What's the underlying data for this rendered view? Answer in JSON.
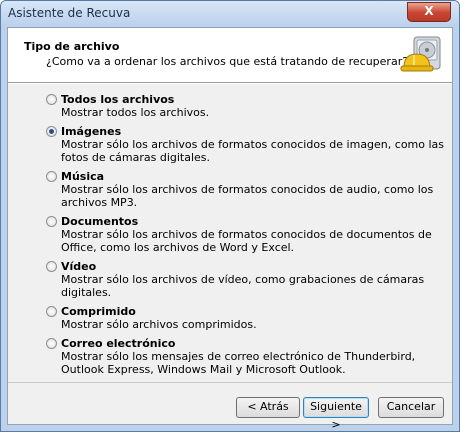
{
  "window": {
    "title": "Asistente de Recuva",
    "close_label": "X"
  },
  "header": {
    "title": "Tipo de archivo",
    "subtitle": "¿Como va a ordenar los archivos que está tratando de recuperar?",
    "logo_icon": "recuva-hardhat-disk-icon"
  },
  "options": [
    {
      "label": "Todos los archivos",
      "desc": "Mostrar todos los archivos.",
      "selected": false
    },
    {
      "label": "Imágenes",
      "desc": "Mostrar sólo los archivos de formatos conocidos de imagen, como las fotos de cámaras digitales.",
      "selected": true
    },
    {
      "label": "Música",
      "desc": "Mostrar sólo los archivos de formatos conocidos de audio, como los archivos MP3.",
      "selected": false
    },
    {
      "label": "Documentos",
      "desc": "Mostrar sólo los archivos de formatos conocidos de documentos de Office, como los archivos de Word y Excel.",
      "selected": false
    },
    {
      "label": "Vídeo",
      "desc": "Mostrar sólo los archivos de vídeo, como grabaciones de cámaras digitales.",
      "selected": false
    },
    {
      "label": "Comprimido",
      "desc": "Mostrar sólo archivos comprimidos.",
      "selected": false
    },
    {
      "label": "Correo electrónico",
      "desc": "Mostrar sólo los mensajes de correo electrónico de Thunderbird, Outlook Express, Windows Mail y Microsoft Outlook.",
      "selected": false
    }
  ],
  "buttons": {
    "back": "< Atrás",
    "next": "Siguiente >",
    "cancel": "Cancelar"
  },
  "colors": {
    "frame": "#bcd2ec",
    "close": "#c84531",
    "selected_radio": "#2a4f8a"
  }
}
